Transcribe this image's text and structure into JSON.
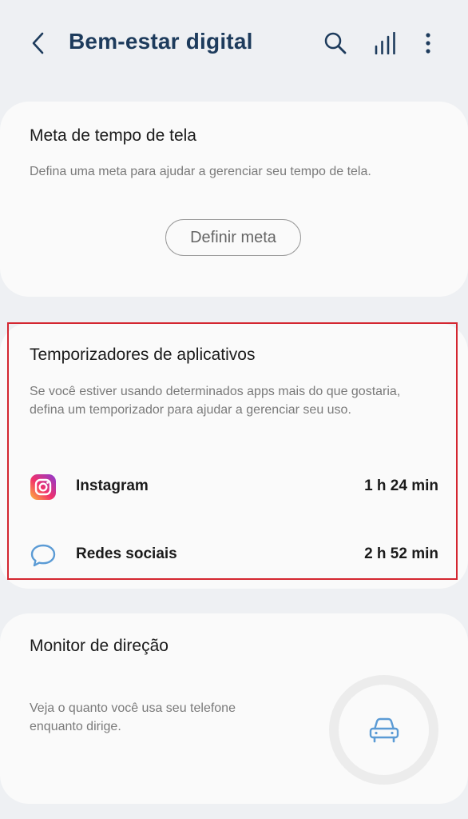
{
  "header": {
    "title": "Bem-estar digital",
    "icons": [
      "back-arrow-icon",
      "search-icon",
      "bar-chart-icon",
      "more-vert-icon"
    ]
  },
  "screen_time_goal": {
    "title": "Meta de tempo de tela",
    "description": "Defina uma meta para ajudar a gerenciar seu tempo de tela.",
    "button_label": "Definir meta"
  },
  "app_timers": {
    "title": "Temporizadores de aplicativos",
    "description": "Se você estiver usando determinados apps mais do que gostaria, defina um temporizador para ajudar a gerenciar seu uso.",
    "items": [
      {
        "name": "Instagram",
        "time": "1 h 24 min",
        "icon": "instagram-icon"
      },
      {
        "name": "Redes sociais",
        "time": "2 h 52 min",
        "icon": "chat-bubble-icon"
      }
    ]
  },
  "driving_monitor": {
    "title": "Monitor de direção",
    "description": "Veja o quanto você usa seu telefone enquanto dirige.",
    "icon": "car-icon"
  },
  "colors": {
    "background": "#eef0f3",
    "card": "#fafafa",
    "title": "#1d3b5c",
    "highlight": "#d42630",
    "accent": "#5b9bd5"
  }
}
